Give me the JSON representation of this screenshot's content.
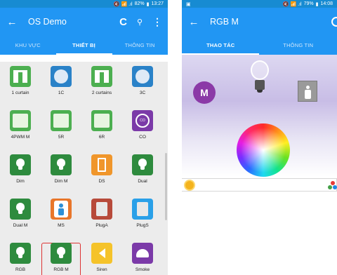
{
  "left": {
    "status": {
      "icons": "🔇 📶 .ıl",
      "battery": "82%",
      "time": "13:27"
    },
    "appbar": {
      "title": "OS Demo",
      "back": "←",
      "refresh": "C",
      "search": "🔍",
      "more": "⋮"
    },
    "tabs": [
      "KHU VỰC",
      "THIẾT BỊ",
      "THÔNG TIN"
    ],
    "devices": [
      {
        "label": "1 curtain",
        "color": "#4caf50",
        "icon": "curtain-icon"
      },
      {
        "label": "1C",
        "color": "#2a82c8",
        "icon": "switch-icon"
      },
      {
        "label": "2 curtains",
        "color": "#4caf50",
        "icon": "curtain-icon"
      },
      {
        "label": "3C",
        "color": "#2a82c8",
        "icon": "switch-icon"
      },
      {
        "label": "4PWM M",
        "color": "#4caf50",
        "icon": "panel-icon"
      },
      {
        "label": "5R",
        "color": "#4caf50",
        "icon": "panel-icon"
      },
      {
        "label": "6R",
        "color": "#4caf50",
        "icon": "panel-icon"
      },
      {
        "label": "CO",
        "color": "#7b3aa8",
        "icon": "co-sensor-icon"
      },
      {
        "label": "Dim",
        "color": "#2e8b3e",
        "icon": "bulb-icon"
      },
      {
        "label": "Dim M",
        "color": "#2e8b3e",
        "icon": "bulb-icon"
      },
      {
        "label": "DS",
        "color": "#f0962b",
        "icon": "door-icon"
      },
      {
        "label": "Dual",
        "color": "#2e8b3e",
        "icon": "bulb-icon"
      },
      {
        "label": "Dual M",
        "color": "#2e8b3e",
        "icon": "bulb-icon"
      },
      {
        "label": "MS",
        "color": "#e8762a",
        "icon": "person-icon"
      },
      {
        "label": "PlugA",
        "color": "#b74a3a",
        "icon": "plug-icon"
      },
      {
        "label": "PlugS",
        "color": "#2aa0e8",
        "icon": "plug-icon"
      },
      {
        "label": "RGB",
        "color": "#2e8b3e",
        "icon": "bulb-icon"
      },
      {
        "label": "RGB M",
        "color": "#2e8b3e",
        "icon": "bulb-icon",
        "selected": true
      },
      {
        "label": "Siren",
        "color": "#f5c32a",
        "icon": "speaker-icon"
      },
      {
        "label": "Smoke",
        "color": "#7b3aa8",
        "icon": "smoke-detector-icon"
      }
    ]
  },
  "right": {
    "status": {
      "left": "▣",
      "icons": "🔇 📶 .ıl",
      "battery": "79%",
      "time": "14:08"
    },
    "appbar": {
      "title": "RGB M",
      "back": "←",
      "clock": "🕓"
    },
    "tabs": [
      "THAO TÁC",
      "THÔNG TIN"
    ],
    "mode_button": "M",
    "colors": {
      "accent": "#2196f3",
      "mode": "#8b3aa7"
    }
  }
}
